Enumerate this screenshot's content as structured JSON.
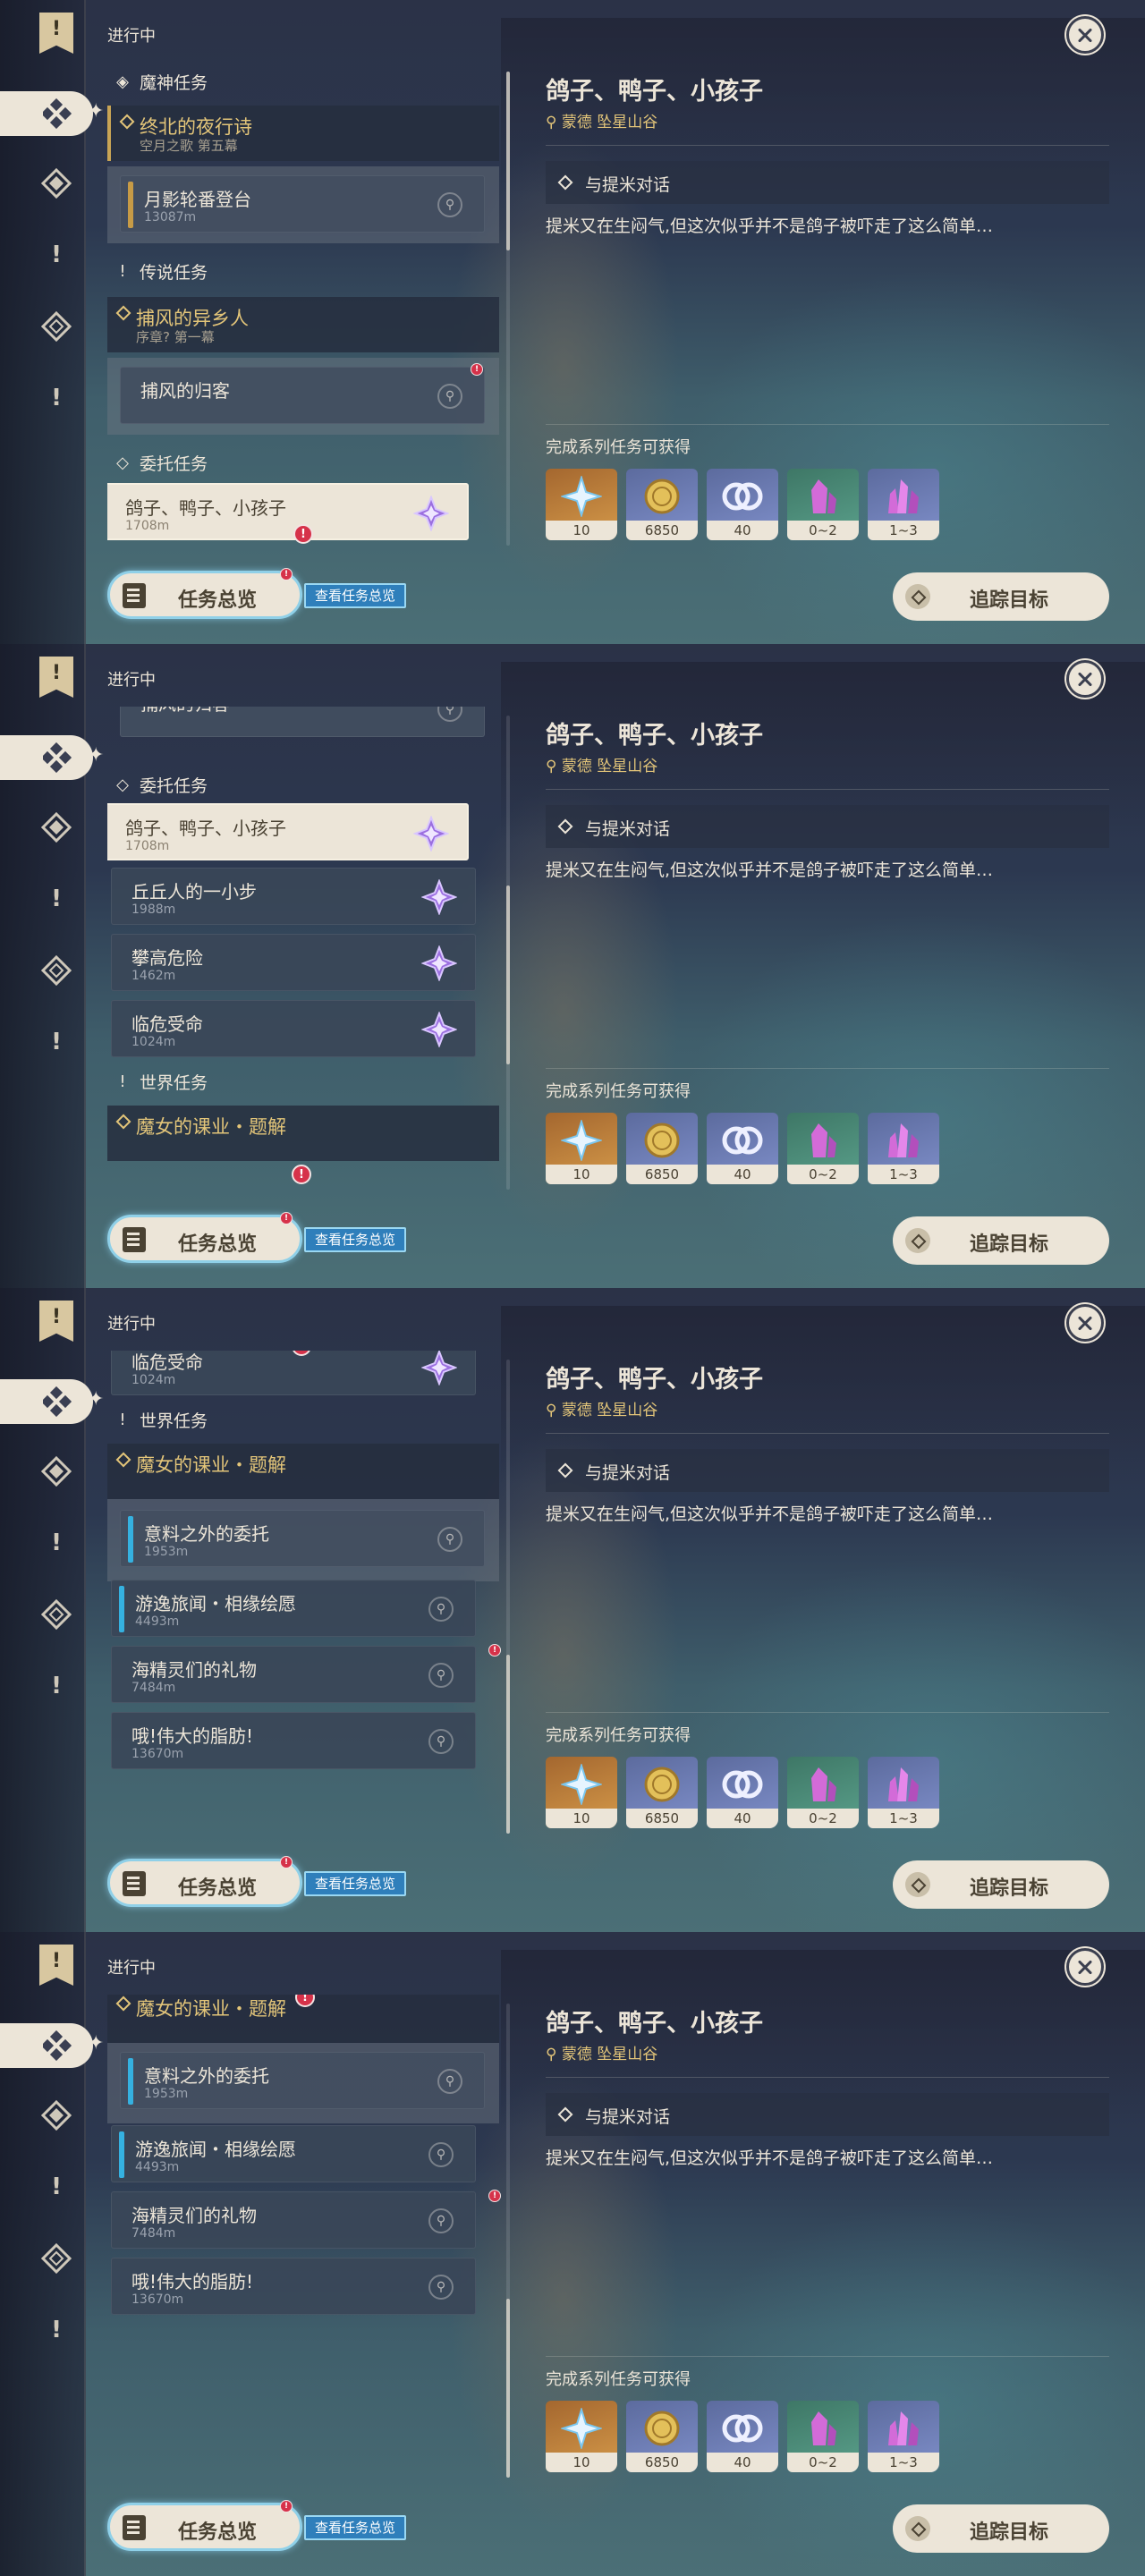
{
  "header": {
    "status_label": "进行中"
  },
  "rail": {
    "bookmark_icon": "bookmark-icon",
    "icons": [
      "archon-quest-icon",
      "story-quest-icon",
      "world-quest-icon",
      "commission-icon",
      "world-quest-icon"
    ]
  },
  "categories": {
    "archon": "魔神任务",
    "legend": "传说任务",
    "commission": "委托任务",
    "world": "世界任务"
  },
  "quests": {
    "archon_chain": {
      "title": "终北的夜行诗",
      "subtitle": "空月之歌 第五幕"
    },
    "archon_step": {
      "title": "月影轮番登台",
      "distance": "13087m"
    },
    "legend_chain": {
      "title": "捕风的异乡人",
      "subtitle": "序章? 第一幕"
    },
    "legend_step": {
      "title": "捕风的归客"
    },
    "commission_1": {
      "title": "鸽子、鸭子、小孩子",
      "distance": "1708m"
    },
    "commission_2": {
      "title": "丘丘人的一小步",
      "distance": "1988m"
    },
    "commission_3": {
      "title": "攀高危险",
      "distance": "1462m"
    },
    "commission_4": {
      "title": "临危受命",
      "distance": "1024m"
    },
    "world_chain": {
      "title": "魔女的课业・题解"
    },
    "world_1": {
      "title": "意料之外的委托",
      "distance": "1953m"
    },
    "world_2": {
      "title": "游逸旅闻・相缘绘愿",
      "distance": "4493m"
    },
    "world_3": {
      "title": "海精灵们的礼物",
      "distance": "7484m"
    },
    "world_4": {
      "title": "哦!伟大的脂肪!",
      "distance": "13670m"
    }
  },
  "detail": {
    "title": "鸽子、鸭子、小孩子",
    "location": "蒙德 坠星山谷",
    "objective": "与提米对话",
    "description": "提米又在生闷气,但这次似乎并不是鸽子被吓走了这么简单…",
    "rewards_label": "完成系列任务可获得",
    "rewards": [
      {
        "icon": "primogem-icon",
        "count": "10",
        "color": "#c48840"
      },
      {
        "icon": "mora-icon",
        "count": "6850",
        "color": "#6a78b0"
      },
      {
        "icon": "companionship-exp-icon",
        "count": "40",
        "color": "#6a78b0"
      },
      {
        "icon": "crystal-icon",
        "count": "0~2",
        "color": "#4c8b78"
      },
      {
        "icon": "crystal-cluster-icon",
        "count": "1~3",
        "color": "#6a78b0"
      }
    ]
  },
  "buttons": {
    "overview": "任务总览",
    "overview_tip": "查看任务总览",
    "track": "追踪目标"
  },
  "badge_symbol": "!"
}
